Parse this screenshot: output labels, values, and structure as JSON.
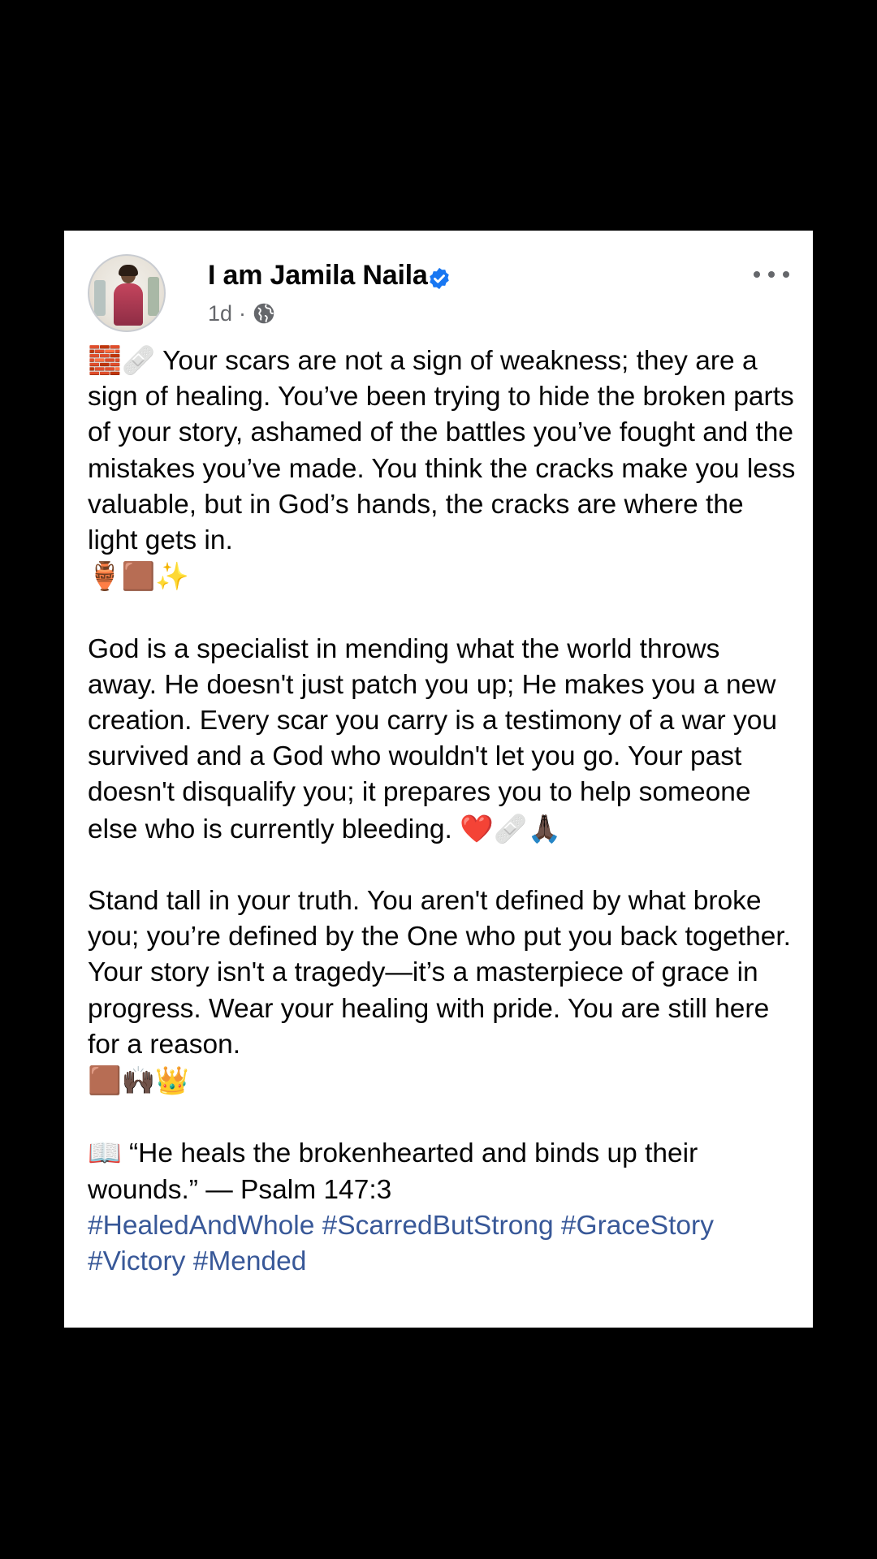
{
  "post": {
    "author_name": "I am Jamila Naila",
    "timestamp": "1d",
    "meta_separator": "·",
    "audience_icon": "globe-icon",
    "verified_icon": "verified-badge-icon",
    "more_icon": "more-options-icon",
    "paragraphs": [
      {
        "lead_emoji": "🧱🩹",
        "text": " Your scars are not a sign of weakness; they are a sign of healing. You’ve been trying to hide the broken parts of your story, ashamed of the battles you’ve fought and the mistakes you’ve made. You think the cracks make you less valuable, but in God’s hands, the cracks are where the light gets in.",
        "trail_emoji": "🏺🟫✨"
      },
      {
        "lead_emoji": "",
        "text": "God is a specialist in mending what the world throws away. He doesn't just patch you up; He makes you a new creation. Every scar you carry is a testimony of a war you survived and a God who wouldn't let you go. Your past doesn't disqualify you; it prepares you to help someone else who is currently bleeding.",
        "trail_emoji": "❤️🩹🙏🏿"
      },
      {
        "lead_emoji": "",
        "text": "Stand tall in your truth. You aren't defined by what broke you; you’re defined by the One who put you back together. Your story isn't a tragedy—it’s a masterpiece of grace in progress. Wear your healing with pride. You are still here for a reason.",
        "trail_emoji": "🟫🙌🏿👑"
      }
    ],
    "verse": {
      "lead_emoji": "📖",
      "text": " “He heals the brokenhearted and binds up their wounds.” — Psalm 147:3"
    },
    "hashtags": [
      "#HealedAndWhole",
      "#ScarredButStrong",
      "#GraceStory",
      "#Victory",
      "#Mended"
    ]
  },
  "colors": {
    "background": "#000000",
    "card": "#ffffff",
    "text": "#050505",
    "meta": "#65676b",
    "hashtag": "#385898",
    "verified": "#1877f2"
  }
}
